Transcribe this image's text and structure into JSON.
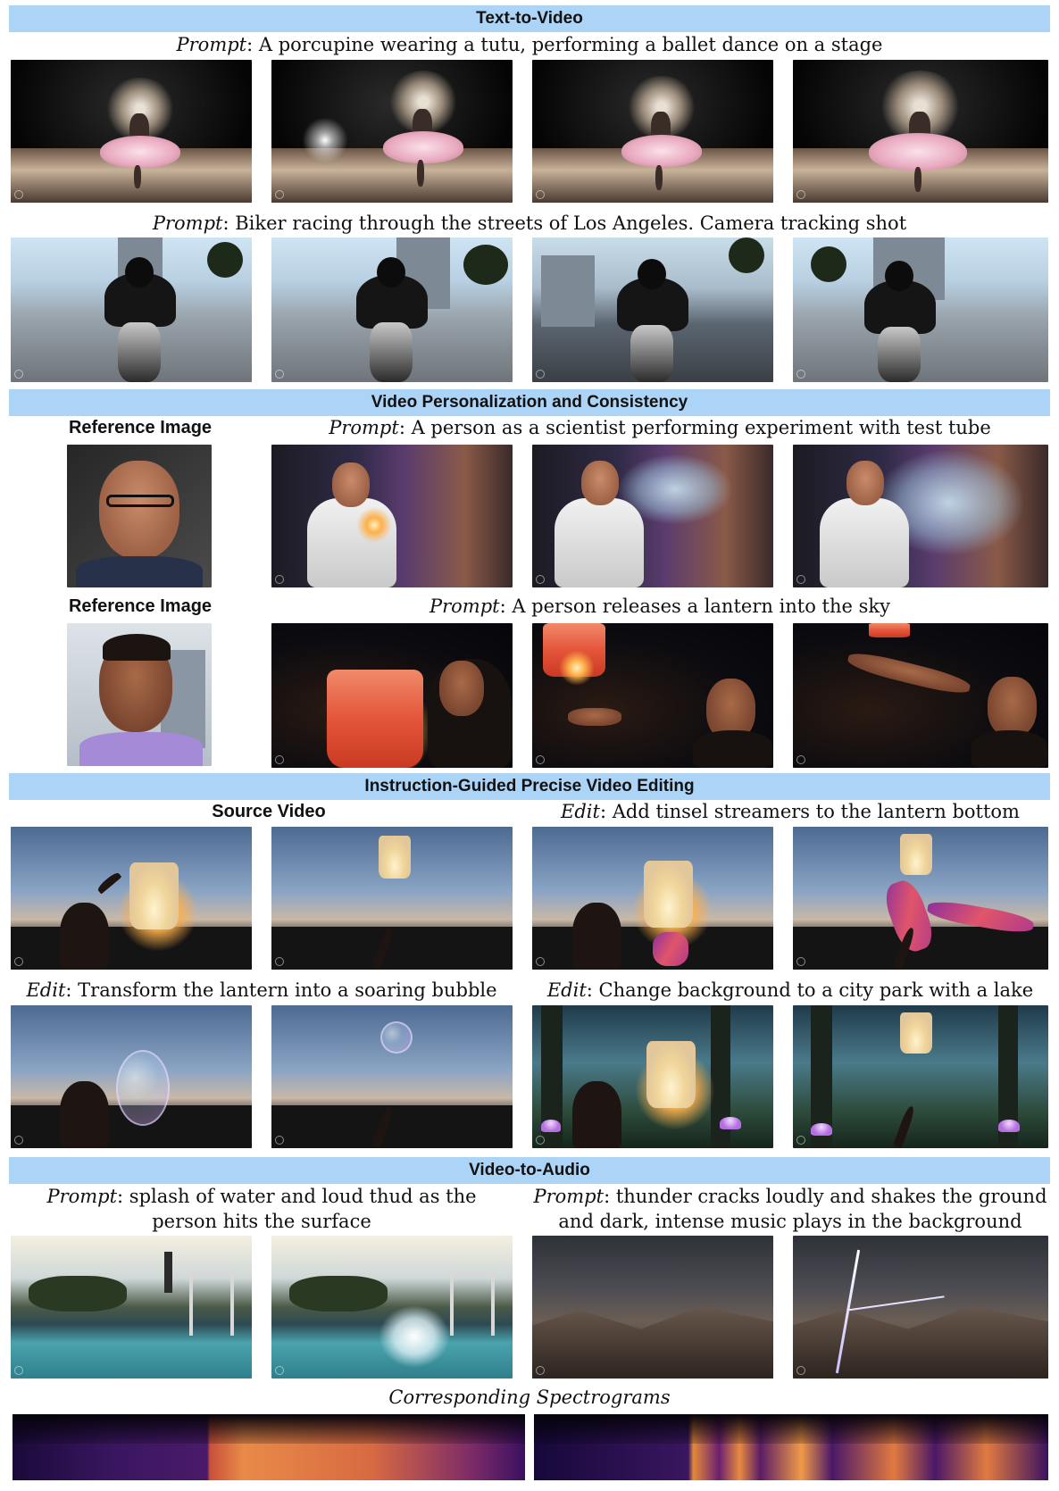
{
  "sections": {
    "t2v": "Text-to-Video",
    "personalization": "Video Personalization and Consistency",
    "editing": "Instruction-Guided Precise Video Editing",
    "v2a": "Video-to-Audio"
  },
  "labels": {
    "prompt": "Prompt",
    "edit": "Edit",
    "reference_image": "Reference Image",
    "source_video": "Source Video",
    "corresponding_spectrograms": "Corresponding Spectrograms"
  },
  "t2v": {
    "prompt1": ": A porcupine wearing a tutu, performing a ballet dance on a stage",
    "prompt2": ": Biker racing through the streets of Los Angeles. Camera tracking shot"
  },
  "personalization": {
    "prompt1": ": A person as a scientist performing experiment with test tube",
    "prompt2": ": A person releases a lantern into the sky"
  },
  "editing": {
    "edit1": ": Add tinsel streamers to the lantern bottom",
    "edit2": ": Transform the lantern into a soaring bubble",
    "edit3": ": Change background to a city park with a lake"
  },
  "v2a": {
    "prompt1_line1": ": splash of water and loud thud as the",
    "prompt1_line2": "person hits the surface",
    "prompt2_line1": ": thunder cracks loudly and shakes the ground",
    "prompt2_line2": "and dark, intense music plays in the background"
  },
  "colors": {
    "section_bar": "#acd4f7"
  }
}
